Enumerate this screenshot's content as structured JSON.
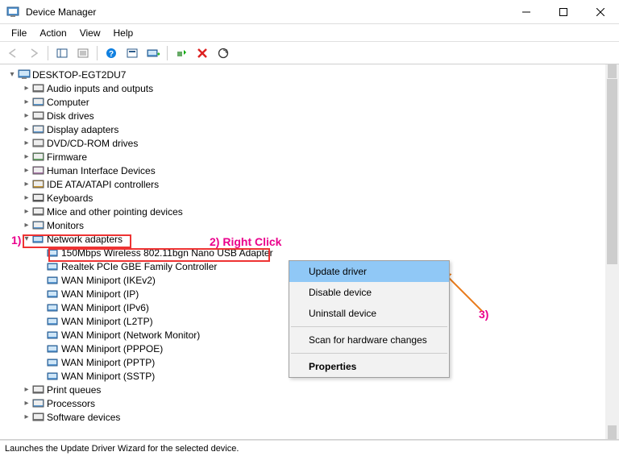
{
  "window": {
    "title": "Device Manager"
  },
  "menubar": {
    "items": [
      "File",
      "Action",
      "View",
      "Help"
    ]
  },
  "tree": {
    "root": "DESKTOP-EGT2DU7",
    "categories": [
      "Audio inputs and outputs",
      "Computer",
      "Disk drives",
      "Display adapters",
      "DVD/CD-ROM drives",
      "Firmware",
      "Human Interface Devices",
      "IDE ATA/ATAPI controllers",
      "Keyboards",
      "Mice and other pointing devices",
      "Monitors"
    ],
    "network_label": "Network adapters",
    "network_devices": [
      "150Mbps Wireless 802.11bgn Nano USB Adapter",
      "Realtek PCIe GBE Family Controller",
      "WAN Miniport (IKEv2)",
      "WAN Miniport (IP)",
      "WAN Miniport (IPv6)",
      "WAN Miniport (L2TP)",
      "WAN Miniport (Network Monitor)",
      "WAN Miniport (PPPOE)",
      "WAN Miniport (PPTP)",
      "WAN Miniport (SSTP)"
    ],
    "after": [
      "Print queues",
      "Processors",
      "Software devices"
    ]
  },
  "context_menu": {
    "items": {
      "update": "Update driver",
      "disable": "Disable device",
      "uninstall": "Uninstall device",
      "scan": "Scan for hardware changes",
      "properties": "Properties"
    }
  },
  "statusbar": {
    "text": "Launches the Update Driver Wizard for the selected device."
  },
  "annotations": {
    "one": "1)",
    "two": "2) Right Click",
    "three": "3)"
  },
  "colors": {
    "annotation": "#ea008c",
    "highlight_border": "#e33",
    "ctx_hl": "#90c8f6",
    "arrow": "#e87b1c"
  }
}
